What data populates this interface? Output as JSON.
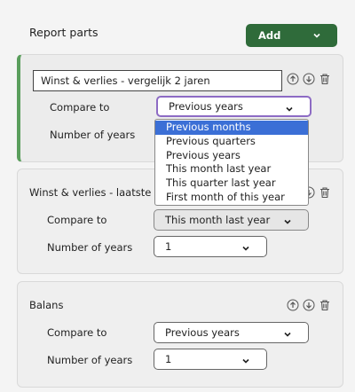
{
  "header": {
    "title": "Report parts",
    "add_label": "Add"
  },
  "cards": [
    {
      "title": "Winst & verlies - vergelijk 2 jaren",
      "compare_label": "Compare to",
      "compare_value": "Previous years",
      "years_label": "Number of years"
    },
    {
      "title": "Winst & verlies - laatste 3 m",
      "compare_label": "Compare to",
      "compare_value": "This month last year",
      "years_label": "Number of years",
      "years_value": "1"
    },
    {
      "title": "Balans",
      "compare_label": "Compare to",
      "compare_value": "Previous years",
      "years_label": "Number of years",
      "years_value": "1"
    }
  ],
  "dropdown": {
    "options": [
      "Previous months",
      "Previous quarters",
      "Previous years",
      "This month last year",
      "This quarter last year",
      "First month of this year"
    ],
    "highlighted": "Previous months"
  },
  "colors": {
    "add_button": "#2f6b3a",
    "active_border": "#5a9e5c",
    "focus_ring": "#8d6bc4",
    "highlight": "#3b6fd6"
  }
}
